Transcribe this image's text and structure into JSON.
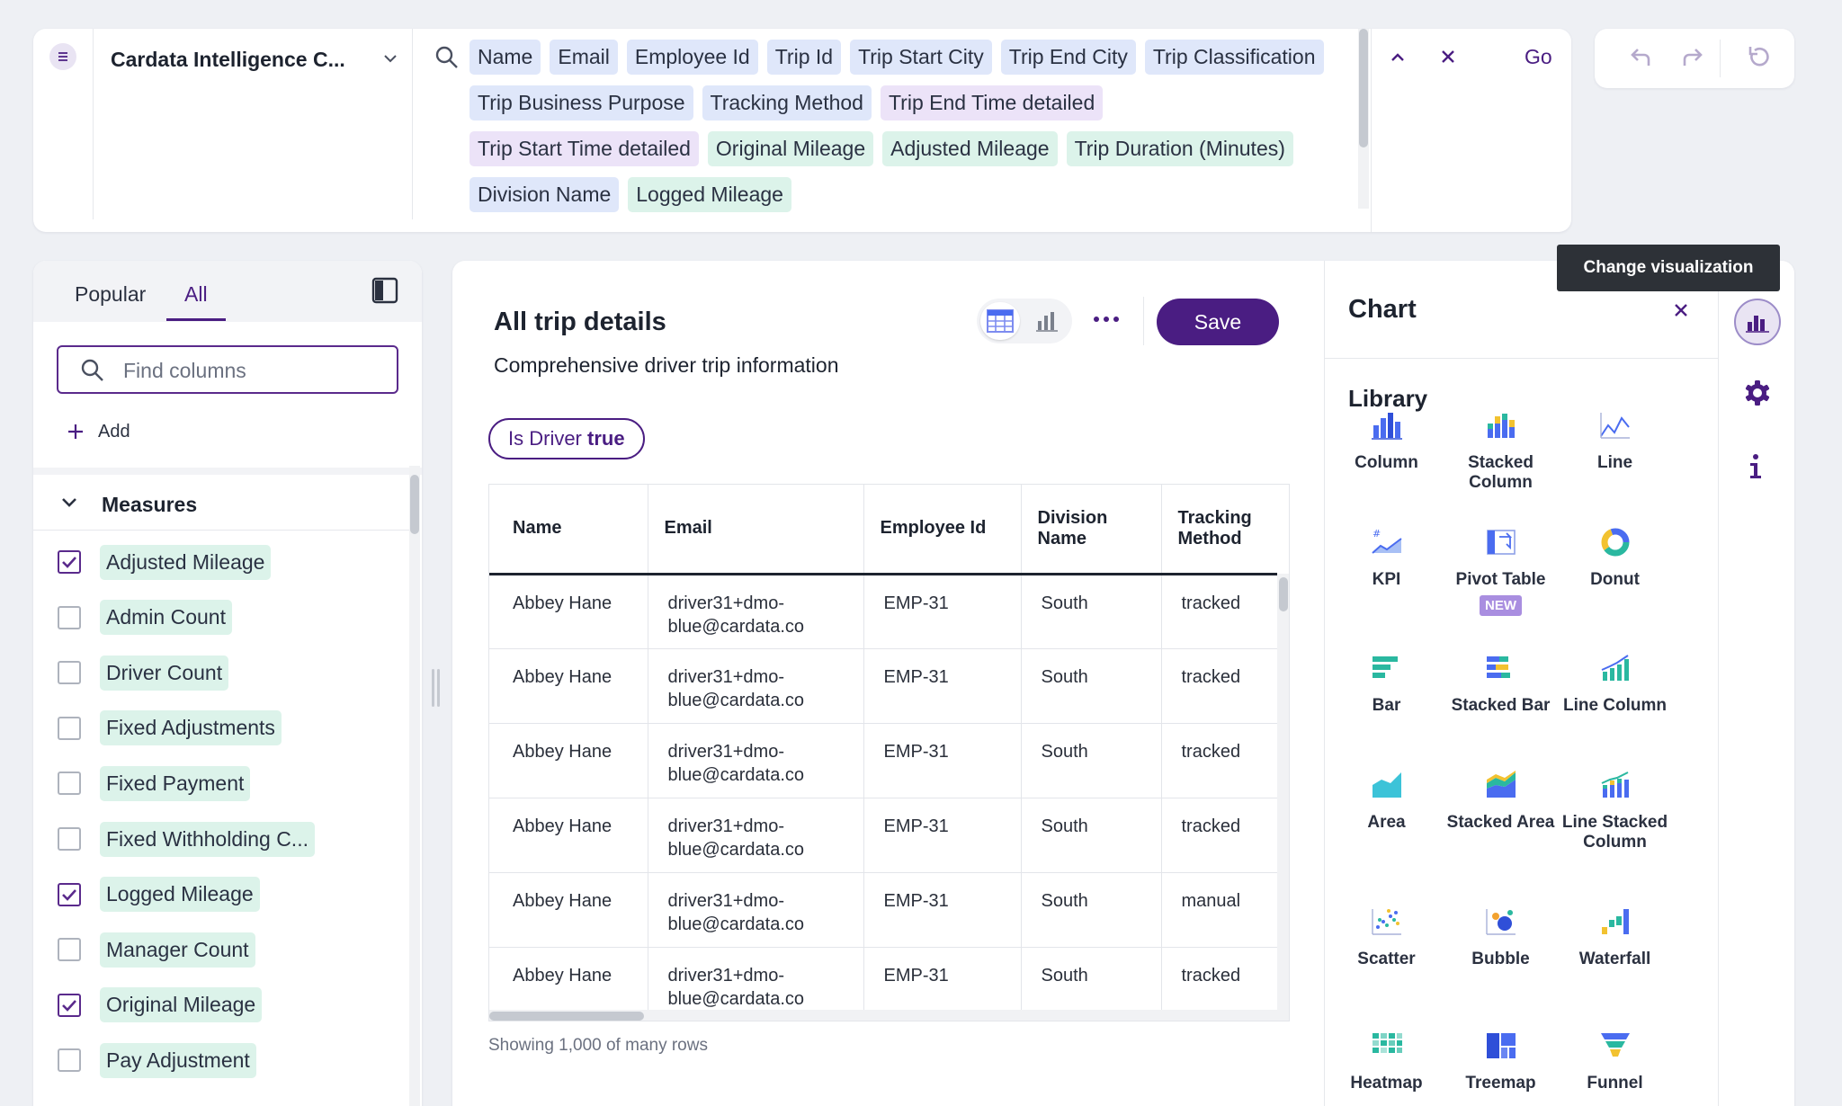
{
  "search": {
    "source_name": "Cardata Intelligence C...",
    "tokens": [
      {
        "label": "Name",
        "kind": "attr"
      },
      {
        "label": "Email",
        "kind": "attr"
      },
      {
        "label": "Employee Id",
        "kind": "attr"
      },
      {
        "label": "Trip Id",
        "kind": "attr"
      },
      {
        "label": "Trip Start City",
        "kind": "attr"
      },
      {
        "label": "Trip End City",
        "kind": "attr"
      },
      {
        "label": "Trip Classification",
        "kind": "attr"
      },
      {
        "label": "Trip Business Purpose",
        "kind": "attr"
      },
      {
        "label": "Tracking Method",
        "kind": "attr"
      },
      {
        "label": "Trip End Time detailed",
        "kind": "purp"
      },
      {
        "label": "Trip Start Time detailed",
        "kind": "purp"
      },
      {
        "label": "Original Mileage",
        "kind": "meas"
      },
      {
        "label": "Adjusted Mileage",
        "kind": "meas"
      },
      {
        "label": "Trip Duration (Minutes)",
        "kind": "meas"
      },
      {
        "label": "Division Name",
        "kind": "attr"
      },
      {
        "label": "Logged Mileage",
        "kind": "meas"
      }
    ],
    "go_label": "Go"
  },
  "left_panel": {
    "tabs": [
      "Popular",
      "All"
    ],
    "active_tab": "All",
    "find_placeholder": "Find columns",
    "add_label": "Add",
    "section_title": "Measures",
    "columns": [
      {
        "label": "Adjusted Mileage",
        "checked": true
      },
      {
        "label": "Admin Count",
        "checked": false
      },
      {
        "label": "Driver Count",
        "checked": false
      },
      {
        "label": "Fixed Adjustments",
        "checked": false
      },
      {
        "label": "Fixed Payment",
        "checked": false
      },
      {
        "label": "Fixed Withholding C...",
        "checked": false
      },
      {
        "label": "Logged Mileage",
        "checked": true
      },
      {
        "label": "Manager Count",
        "checked": false
      },
      {
        "label": "Original Mileage",
        "checked": true
      },
      {
        "label": "Pay Adjustment",
        "checked": false
      }
    ]
  },
  "answer": {
    "title": "All trip details",
    "description": "Comprehensive driver trip information",
    "save_label": "Save",
    "filter": {
      "label": "Is Driver",
      "value": "true"
    },
    "table": {
      "headers": [
        "Name",
        "Email",
        "Employee Id",
        "Division Name",
        "Tracking Method"
      ],
      "rows": [
        [
          "Abbey Hane",
          "driver31+dmo-blue@cardata.co",
          "EMP-31",
          "South",
          "tracked"
        ],
        [
          "Abbey Hane",
          "driver31+dmo-blue@cardata.co",
          "EMP-31",
          "South",
          "tracked"
        ],
        [
          "Abbey Hane",
          "driver31+dmo-blue@cardata.co",
          "EMP-31",
          "South",
          "tracked"
        ],
        [
          "Abbey Hane",
          "driver31+dmo-blue@cardata.co",
          "EMP-31",
          "South",
          "tracked"
        ],
        [
          "Abbey Hane",
          "driver31+dmo-blue@cardata.co",
          "EMP-31",
          "South",
          "manual"
        ],
        [
          "Abbey Hane",
          "driver31+dmo-blue@cardata.co",
          "EMP-31",
          "South",
          "tracked"
        ]
      ]
    },
    "footer": "Showing 1,000 of many rows"
  },
  "chart_panel": {
    "title": "Chart",
    "library_title": "Library",
    "tooltip": "Change visualization",
    "new_badge": "NEW",
    "items": [
      {
        "label": "Column",
        "icon": "column-chart-icon"
      },
      {
        "label": "Stacked Column",
        "icon": "stacked-column-chart-icon"
      },
      {
        "label": "Line",
        "icon": "line-chart-icon"
      },
      {
        "label": "KPI",
        "icon": "kpi-chart-icon"
      },
      {
        "label": "Pivot Table",
        "icon": "pivot-table-icon"
      },
      {
        "label": "Donut",
        "icon": "donut-chart-icon"
      },
      {
        "label": "Bar",
        "icon": "bar-chart-icon"
      },
      {
        "label": "Stacked Bar",
        "icon": "stacked-bar-chart-icon"
      },
      {
        "label": "Line Column",
        "icon": "line-column-chart-icon"
      },
      {
        "label": "Area",
        "icon": "area-chart-icon"
      },
      {
        "label": "Stacked Area",
        "icon": "stacked-area-chart-icon"
      },
      {
        "label": "Line Stacked Column",
        "icon": "line-stacked-column-chart-icon"
      },
      {
        "label": "Scatter",
        "icon": "scatter-chart-icon"
      },
      {
        "label": "Bubble",
        "icon": "bubble-chart-icon"
      },
      {
        "label": "Waterfall",
        "icon": "waterfall-chart-icon"
      },
      {
        "label": "Heatmap",
        "icon": "heatmap-chart-icon"
      },
      {
        "label": "Treemap",
        "icon": "treemap-chart-icon"
      },
      {
        "label": "Funnel",
        "icon": "funnel-chart-icon"
      }
    ]
  },
  "colors": {
    "accent": "#4a1d82",
    "attribute_chip": "#dfe7fa",
    "measure_chip": "#dcf3ea",
    "datetime_chip": "#ece3f8"
  }
}
